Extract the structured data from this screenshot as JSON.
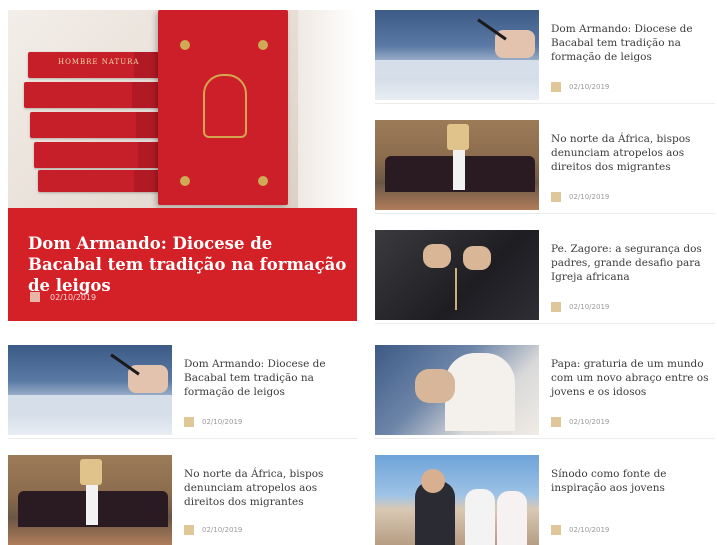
{
  "featured": {
    "title": "Dom Armando: Diocese de Bacabal tem tradição na formação de leigos",
    "date": "02/10/2019",
    "image_icon": "books-photo",
    "book_spine_text": "HOMBRE NATURA"
  },
  "cards": [
    {
      "title": "Dom Armando: Diocese de Bacabal tem tradição na formação de leigos",
      "date": "02/10/2019",
      "thumb": "signing-document-photo"
    },
    {
      "title": "No norte da África, bispos denunciam atropelos aos direitos dos migrantes",
      "date": "02/10/2019",
      "thumb": "group-bishops-photo"
    },
    {
      "title": "Pe. Zagore: a segurança dos padres, grande desafio para Igreja africana",
      "date": "02/10/2019",
      "thumb": "rosary-hands-photo"
    },
    {
      "title": "Papa: graturia de um mundo com um novo abraço entre os jovens e os idosos",
      "date": "02/10/2019",
      "thumb": "pope-embrace-photo"
    },
    {
      "title": "Dom Armando: Diocese de Bacabal tem tradição na formação de leigos",
      "date": "02/10/2019",
      "thumb": "signing-document-photo"
    },
    {
      "title": "No norte da África, bispos denunciam atropelos aos direitos dos migrantes",
      "date": "02/10/2019",
      "thumb": "group-bishops-photo"
    },
    {
      "title": "Sínodo como fonte de inspiração aos jovens",
      "date": "02/10/2019",
      "thumb": "square-selfie-photo"
    }
  ],
  "colors": {
    "featured_bg": "#d42027",
    "date_icon": "#e0c79a",
    "title_text": "#3c3c3c"
  }
}
